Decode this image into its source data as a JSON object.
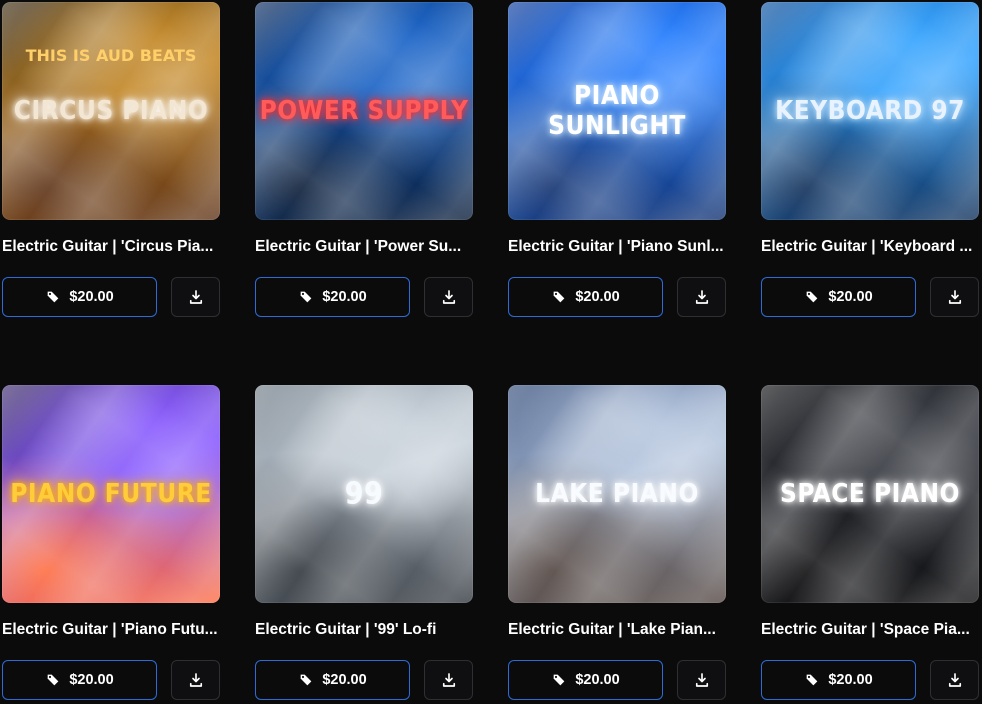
{
  "cards": [
    {
      "title": "Electric Guitar | 'Circus Pia...",
      "cover_text": "CIRCUS PIANO",
      "cover_subtext": "THIS IS AUD BEATS",
      "price": "$20.00",
      "colors": {
        "bg1": "#3a2a12",
        "bg2": "#c58a2a",
        "bg3": "#5a2e12",
        "text": "#f3e6d3",
        "glow": "#ffffff"
      }
    },
    {
      "title": "Electric Guitar | 'Power Su...",
      "cover_text": "POWER SUPPLY",
      "price": "$20.00",
      "colors": {
        "bg1": "#0a2b5d",
        "bg2": "#1d66c9",
        "bg3": "#061833",
        "text": "#ff5b5b",
        "glow": "#ff2a2a"
      }
    },
    {
      "title": "Electric Guitar | 'Piano Sunl...",
      "cover_text": "PIANO SUNLIGHT",
      "price": "$20.00",
      "colors": {
        "bg1": "#0b3c9c",
        "bg2": "#2c82ff",
        "bg3": "#0d2d6d",
        "text": "#ffffff",
        "glow": "#d6ecff"
      }
    },
    {
      "title": "Electric Guitar | 'Keyboard ...",
      "cover_text": "KEYBOARD 97",
      "price": "$20.00",
      "colors": {
        "bg1": "#0a4f9c",
        "bg2": "#3aa6ff",
        "bg3": "#0a2a55",
        "text": "#e8f3ff",
        "glow": "#bfe2ff"
      }
    },
    {
      "title": "Electric Guitar | 'Piano Futu...",
      "cover_text": "PIANO FUTURE",
      "price": "$20.00",
      "colors": {
        "bg1": "#3b2a6a",
        "bg2": "#8a5cff",
        "bg3": "#ff6a3d",
        "text": "#ffcc3a",
        "glow": "#ffb300"
      }
    },
    {
      "title": "Electric Guitar | '99' Lo-fi",
      "cover_text": "99",
      "price": "$20.00",
      "colors": {
        "bg1": "#6f7b86",
        "bg2": "#c9d2db",
        "bg3": "#2b3138",
        "text": "#f6fbff",
        "glow": "#ffffff"
      }
    },
    {
      "title": "Electric Guitar | 'Lake Pian...",
      "cover_text": "LAKE PIANO",
      "price": "$20.00",
      "colors": {
        "bg1": "#314a78",
        "bg2": "#b7c7df",
        "bg3": "#4c3f3a",
        "text": "#f8fbff",
        "glow": "#ffffff"
      }
    },
    {
      "title": "Electric Guitar | 'Space Pia...",
      "cover_text": "SPACE PIANO",
      "price": "$20.00",
      "colors": {
        "bg1": "#111215",
        "bg2": "#3a3d44",
        "bg3": "#09090b",
        "text": "#ffffff",
        "glow": "#ffffff"
      }
    }
  ],
  "icons": {
    "price_tag": "tag-icon",
    "download": "download-icon"
  },
  "colors": {
    "accent": "#2e6bd6",
    "background": "#0b0b0c"
  }
}
